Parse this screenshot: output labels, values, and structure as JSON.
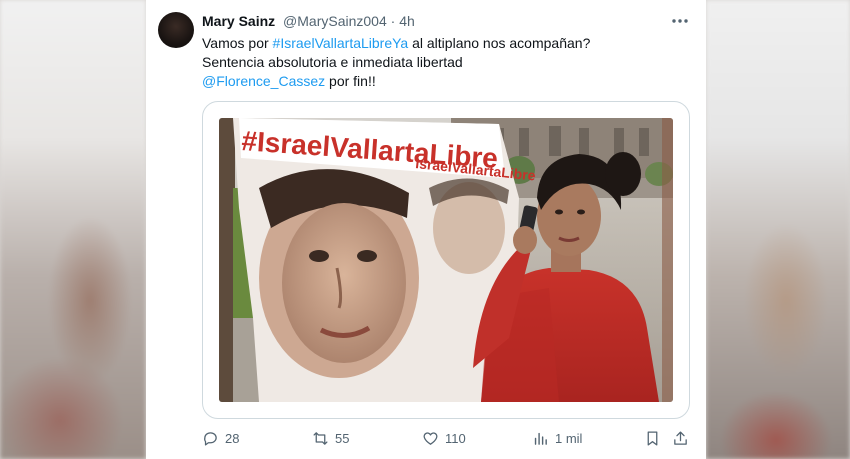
{
  "tweet": {
    "author_name": "Mary Sainz",
    "author_handle": "@MarySainz004",
    "separator": "·",
    "time": "4h",
    "more_icon": "more-horizontal-icon",
    "text_part1": "Vamos por ",
    "hashtag": "#IsraelVallartaLibreYa",
    "text_part2": " al altiplano nos acompañan?",
    "line2": "Sentencia absolutoria e inmediata libertad",
    "mention": "@Florence_Cassez",
    "line3_tail": " por fin!!",
    "link_color": "#1d9bf0"
  },
  "media": {
    "banner_text_1": "#IsraelVallartaLibre",
    "banner_text_2": "IsraelVallartaLibre"
  },
  "actions": {
    "replies": "28",
    "reposts": "55",
    "likes": "110",
    "views": "1 mil",
    "icons": [
      "reply-icon",
      "repost-icon",
      "like-icon",
      "views-icon",
      "bookmark-icon",
      "share-icon"
    ]
  }
}
